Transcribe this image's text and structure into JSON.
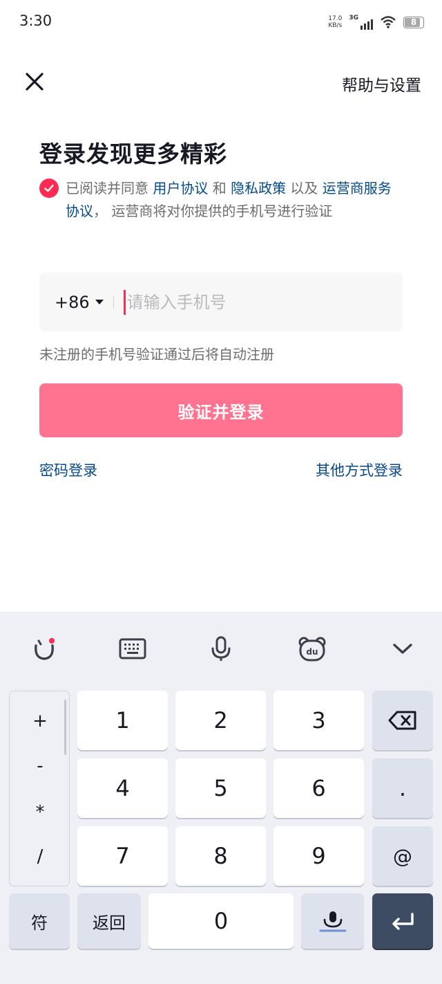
{
  "status_bar": {
    "time": "3:30",
    "net_speed_value": "17.0",
    "net_speed_unit": "KB/s",
    "signal_type": "3G",
    "battery_level": "8",
    "battery_fraction": 0.08
  },
  "header": {
    "close_icon": "close-icon",
    "help_label": "帮助与设置"
  },
  "title": "登录发现更多精彩",
  "agreement": {
    "checked": true,
    "text_prefix": "已阅读并同意 ",
    "user_agreement": "用户协议",
    "and": " 和 ",
    "privacy_policy": "隐私政策",
    "and_also": " 以及 ",
    "carrier_agreement": "运营商服务协议",
    "text_suffix": "， 运营商将对你提供的手机号进行验证"
  },
  "phone": {
    "country_code": "+86",
    "placeholder": "请输入手机号",
    "value": ""
  },
  "hint": "未注册的手机号验证通过后将自动注册",
  "submit_label": "验证并登录",
  "alt_login": {
    "password_login": "密码登录",
    "other_login": "其他方式登录"
  },
  "keyboard": {
    "toolbar_icons": [
      "emoji-face-icon",
      "keyboard-icon",
      "microphone-icon",
      "du-bear-icon",
      "chevron-down-icon"
    ],
    "symbols": [
      "+",
      "-",
      "*",
      "/"
    ],
    "digits": [
      "1",
      "2",
      "3",
      "4",
      "5",
      "6",
      "7",
      "8",
      "9",
      "0"
    ],
    "period": ".",
    "at": "@",
    "symbol_key": "符",
    "back_key": "返回",
    "backspace_icon": "backspace-icon",
    "voice_key_icon": "voice-input-icon",
    "enter_icon": "enter-icon"
  },
  "colors": {
    "accent": "#fe2c55",
    "button_disabled": "#fe7490",
    "link": "#04498d",
    "enter_key": "#3e4c63"
  }
}
